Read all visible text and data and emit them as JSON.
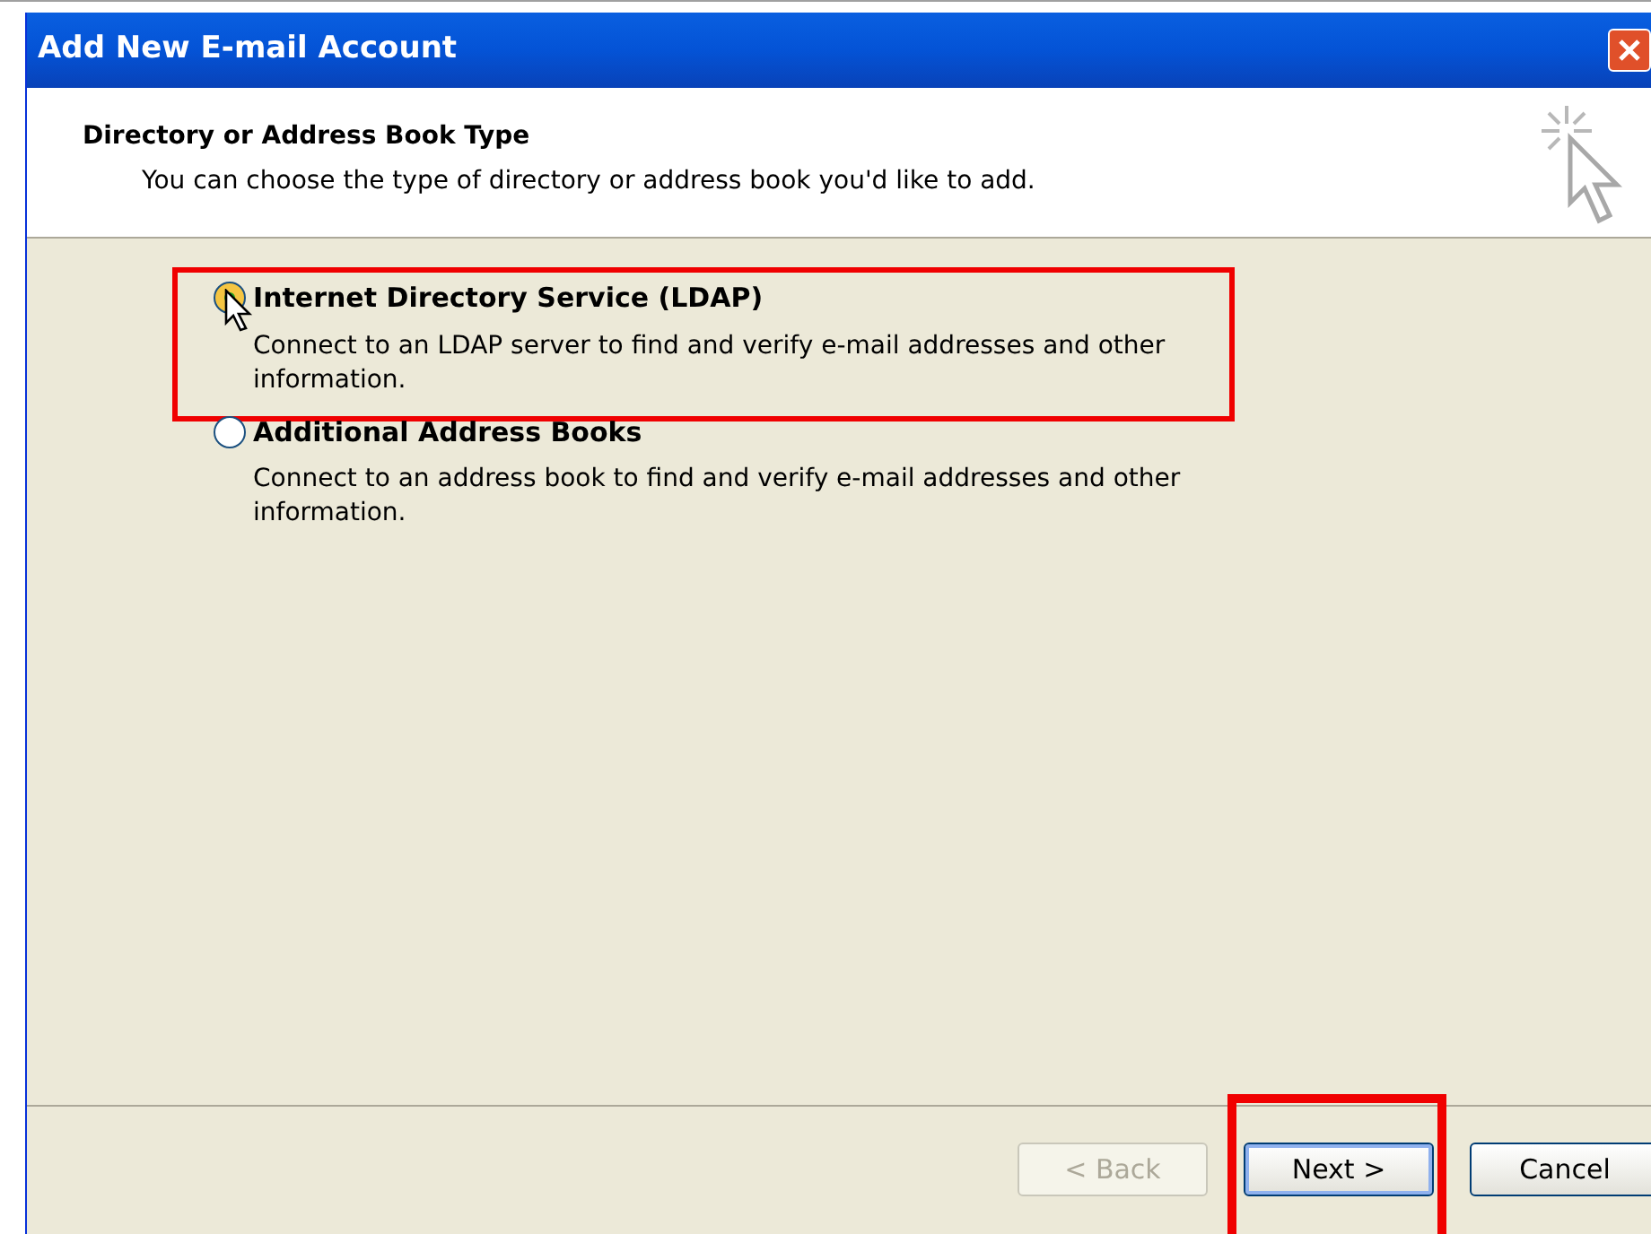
{
  "window": {
    "title": "Add New E-mail Account"
  },
  "header": {
    "title": "Directory or Address Book Type",
    "subtitle": "You can choose the type of directory or address book you'd like to add."
  },
  "options": [
    {
      "label": "Internet Directory Service (LDAP)",
      "description": "Connect to an LDAP server to find and verify e-mail addresses and other information.",
      "selected": true,
      "highlighted": true
    },
    {
      "label": "Additional Address Books",
      "description": "Connect to an address book to find and verify e-mail addresses and other information.",
      "selected": false,
      "highlighted": false
    }
  ],
  "buttons": [
    {
      "label": "< Back",
      "disabled": true,
      "default": false,
      "highlighted": false
    },
    {
      "label": "Next >",
      "disabled": false,
      "default": true,
      "highlighted": true
    },
    {
      "label": "Cancel",
      "disabled": false,
      "default": false,
      "highlighted": false
    }
  ]
}
